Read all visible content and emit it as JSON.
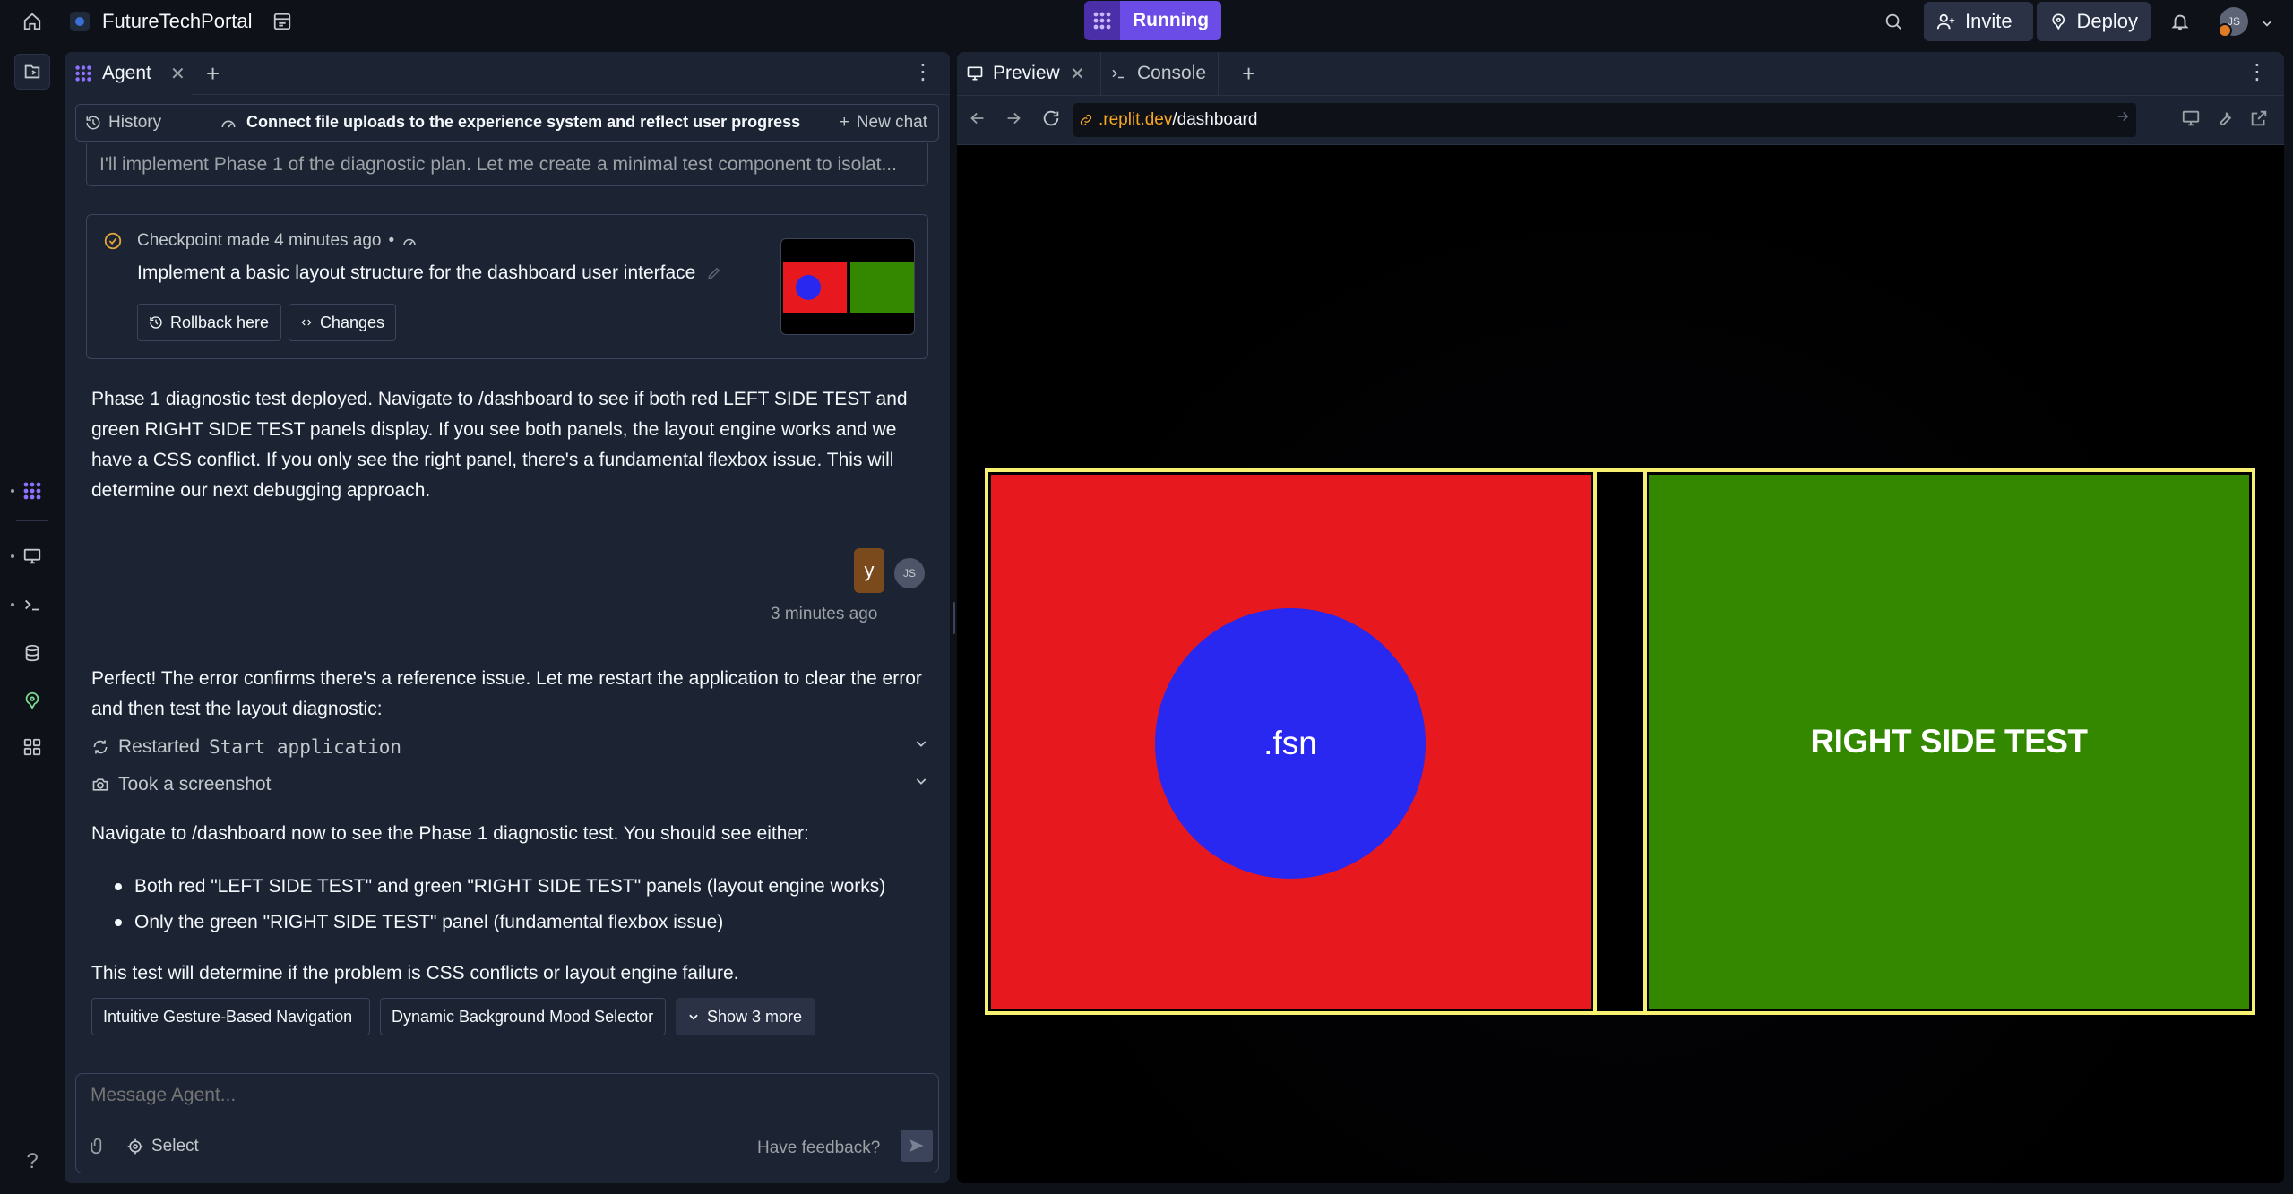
{
  "topbar": {
    "app_name": "FutureTechPortal",
    "run_status": "Running",
    "invite_label": "Invite",
    "deploy_label": "Deploy",
    "avatar_initials": "JS",
    "accent_color": "#6b4ce6"
  },
  "agent": {
    "tab_label": "Agent",
    "history_label": "History",
    "chat_title": "Connect file uploads to the experience system and reflect user progress",
    "new_chat_label": "New chat",
    "previous_message": "I'll implement Phase 1 of the diagnostic plan. Let me create a minimal test component to isolat...",
    "checkpoint": {
      "meta": "Checkpoint made 4 minutes ago",
      "separator": "•",
      "description": "Implement a basic layout structure for the dashboard user interface",
      "rollback_label": "Rollback here",
      "changes_label": "Changes"
    },
    "message1": "Phase 1 diagnostic test deployed. Navigate to /dashboard to see if both red LEFT SIDE TEST and green RIGHT SIDE TEST panels display. If you see both panels, the layout engine works and we have a CSS conflict. If you only see the right panel, there's a fundamental flexbox issue. This will determine our next debugging approach.",
    "user_message": "y",
    "user_initials": "JS",
    "user_time": "3 minutes ago",
    "message2": "Perfect! The error confirms there's a reference issue. Let me restart the application to clear the error and then test the layout diagnostic:",
    "action_restart_prefix": "Restarted",
    "action_restart_code": "Start application",
    "action_screenshot": "Took a screenshot",
    "message3": "Navigate to /dashboard now to see the Phase 1 diagnostic test. You should see either:",
    "bullets": [
      "Both red \"LEFT SIDE TEST\" and green \"RIGHT SIDE TEST\" panels (layout engine works)",
      "Only the green \"RIGHT SIDE TEST\" panel (fundamental flexbox issue)"
    ],
    "message4": "This test will determine if the problem is CSS conflicts or layout engine failure.",
    "suggestions": [
      "Intuitive Gesture-Based Navigation",
      "Dynamic Background Mood Selector"
    ],
    "show_more_label": "Show 3 more",
    "composer_placeholder": "Message Agent...",
    "select_label": "Select",
    "feedback_label": "Have feedback?"
  },
  "preview": {
    "tab_preview": "Preview",
    "tab_console": "Console",
    "url_host": ".replit.dev",
    "url_path": "/dashboard",
    "circle_text": ".fsn",
    "right_panel_text": "RIGHT SIDE TEST",
    "colors": {
      "left_panel": "#e8191e",
      "circle": "#2828f0",
      "right_panel": "#338800",
      "frame_border": "#f7f070"
    }
  },
  "rail": {
    "help_label": "?"
  }
}
